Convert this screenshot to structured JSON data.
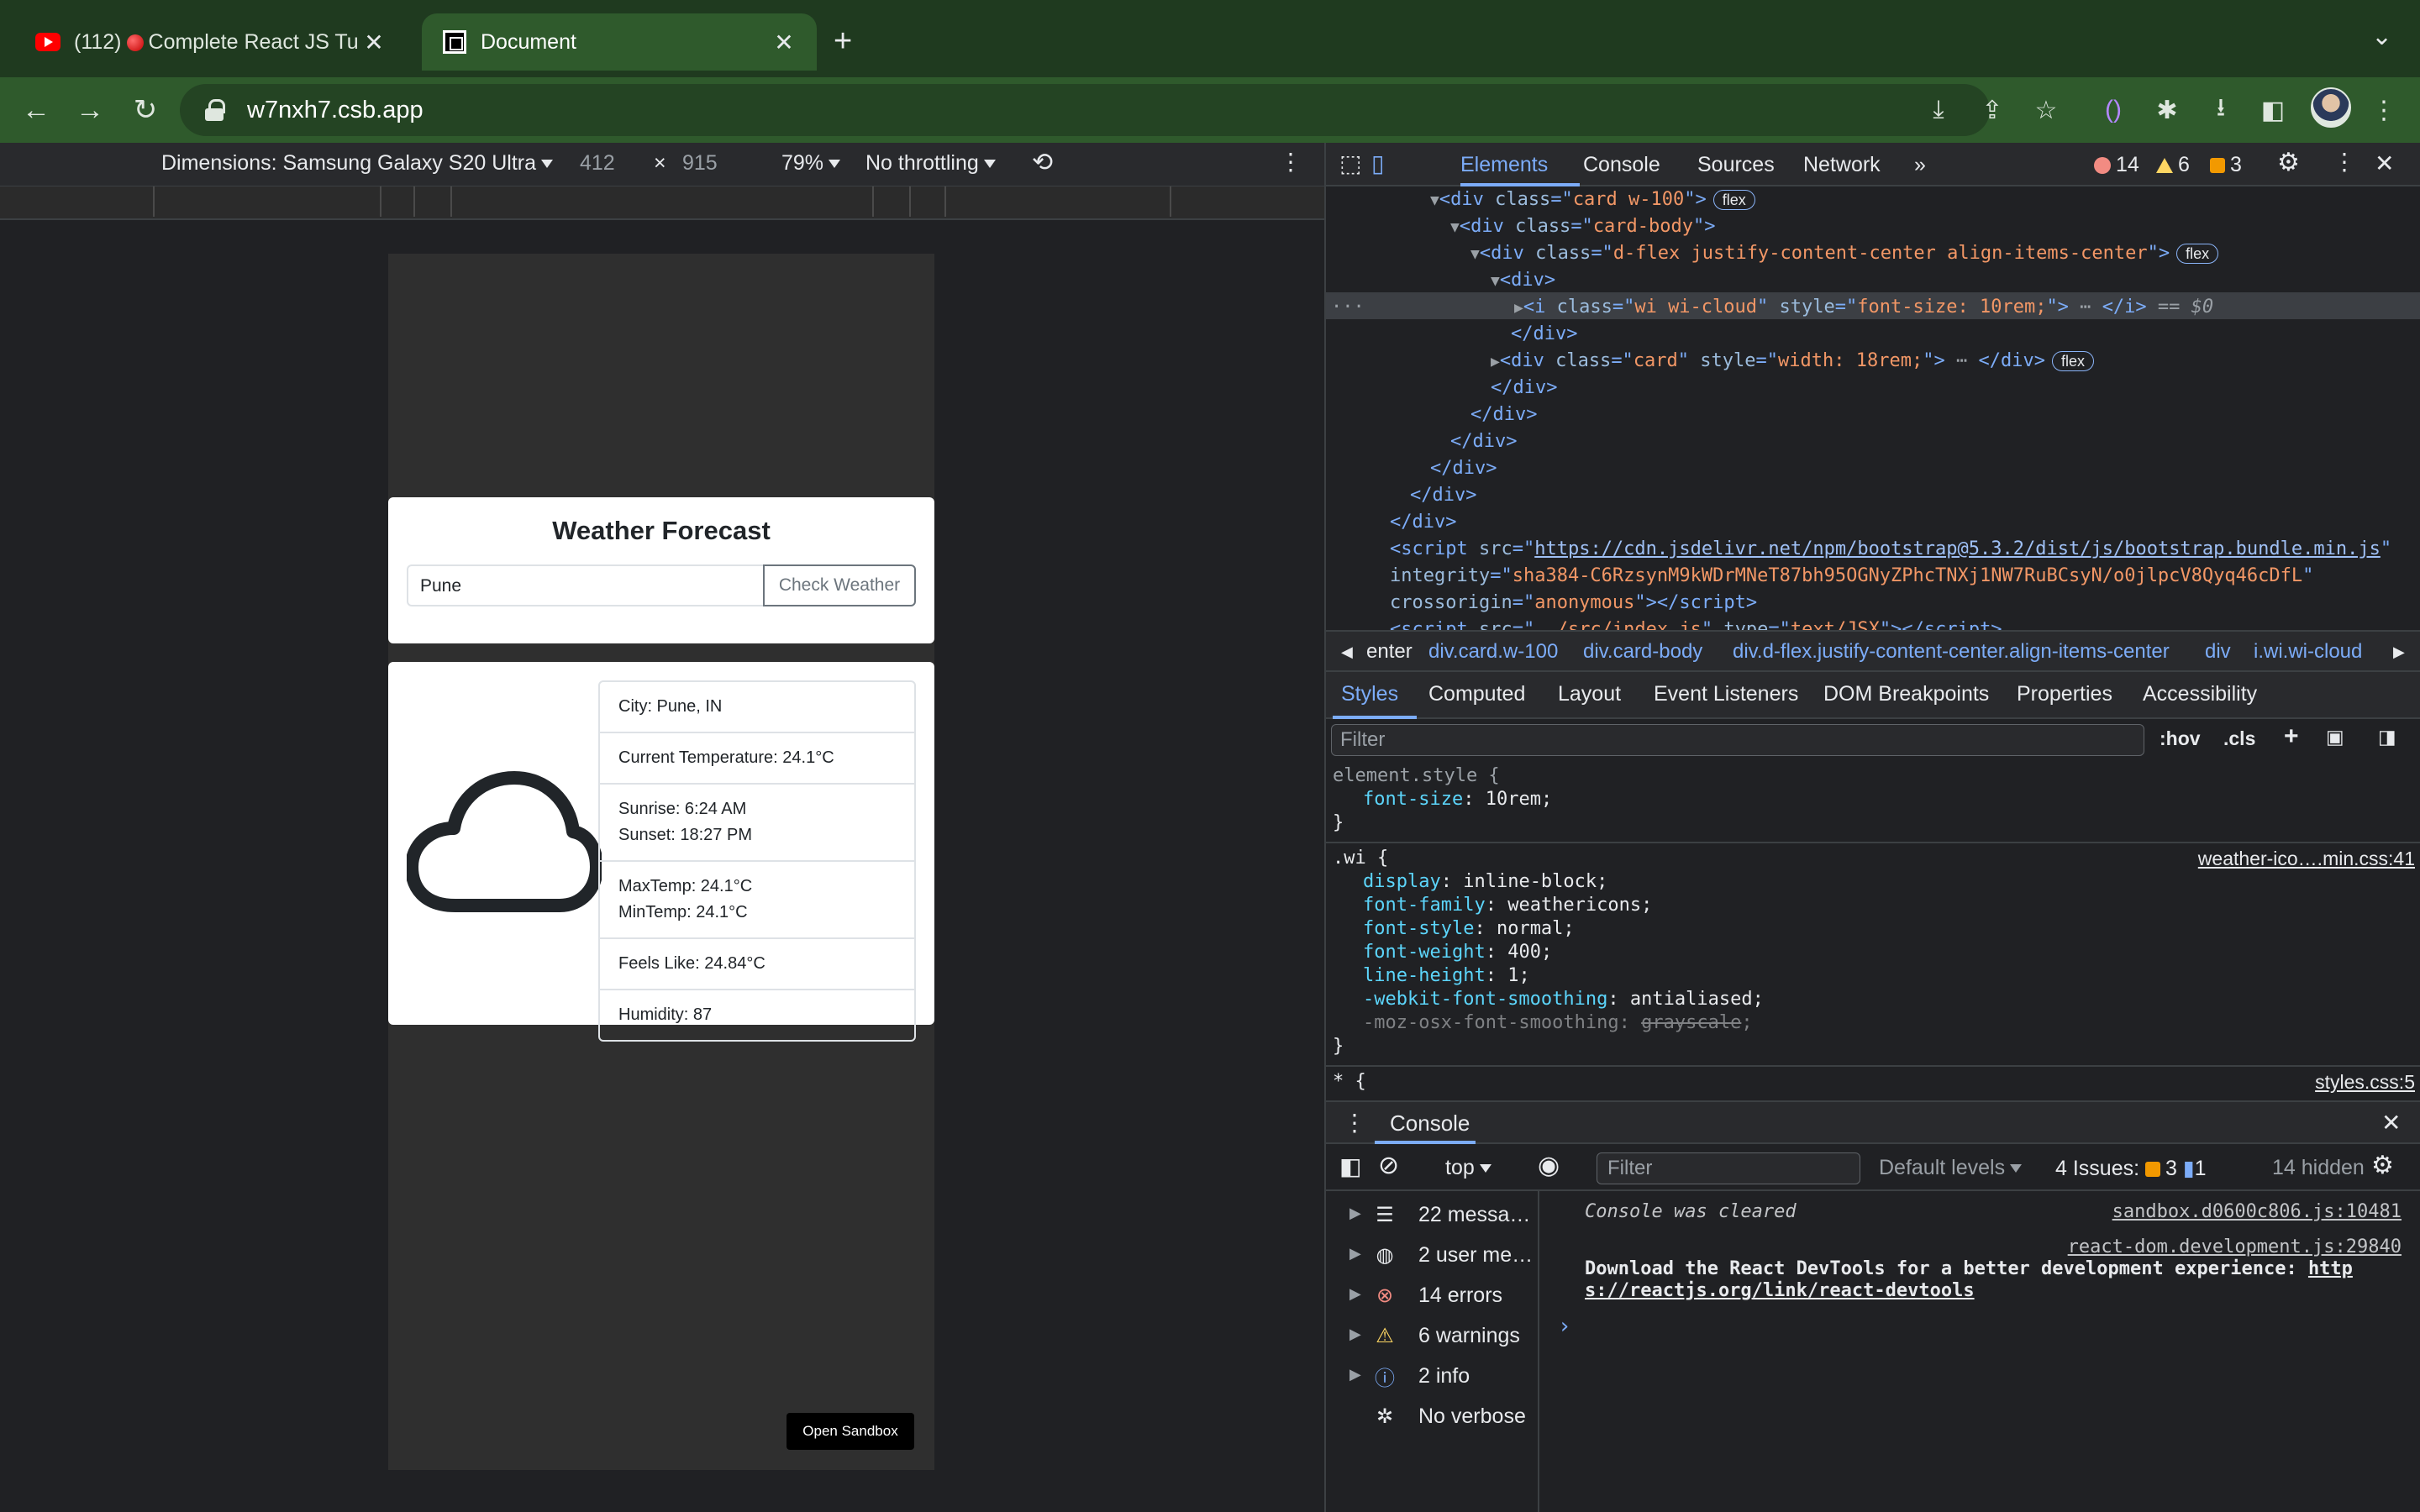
{
  "browser": {
    "tabs": [
      {
        "prefix": "(112)",
        "label": "Complete React JS Tu",
        "active": false
      },
      {
        "label": "Document",
        "active": true
      }
    ],
    "url": "w7nxh7.csb.app"
  },
  "device_toolbar": {
    "dimensions": "Dimensions: Samsung Galaxy S20 Ultra",
    "width": "412",
    "times": "×",
    "height": "915",
    "zoom": "79%",
    "throttling": "No throttling"
  },
  "app": {
    "title": "Weather Forecast",
    "city_value": "Pune",
    "check_button": "Check Weather",
    "info": [
      [
        "City: Pune, IN"
      ],
      [
        "Current Temperature: 24.1°C"
      ],
      [
        "Sunrise: 6:24 AM",
        "Sunset: 18:27 PM"
      ],
      [
        "MaxTemp: 24.1°C",
        "MinTemp: 24.1°C"
      ],
      [
        "Feels Like: 24.84°C"
      ],
      [
        "Humidity: 87"
      ]
    ],
    "open_sandbox": "Open Sandbox"
  },
  "devtools": {
    "tabs": [
      "Elements",
      "Console",
      "Sources",
      "Network"
    ],
    "errors": "14",
    "warnings": "6",
    "issues": "3",
    "dom": {
      "card_div_open": "<div",
      "card_div_class": "card w-100",
      "card_body_class": "card-body",
      "dflex_class": "d-flex justify-content-center align-items-center",
      "icon_class": "wi wi-cloud",
      "icon_style": "font-size: 10rem;",
      "selected_suffix": "== $0",
      "card_style": "width: 18rem;",
      "flex": "flex",
      "script1_src": "https://cdn.jsdelivr.net/npm/bootstrap@5.3.2/dist/js/bootstrap.bundle.min.js",
      "script1_integrity": "sha384-C6RzsynM9kWDrMNeT87bh95OGNyZPhcTNXj1NW7RuBCsyN/o0jlpcV8Qyq46cDfL",
      "script1_crossorigin": "anonymous",
      "script2_src": "../src/index.js",
      "script2_type": "text/JSX"
    },
    "breadcrumbs": [
      "enter",
      "div.card.w-100",
      "div.card-body",
      "div.d-flex.justify-content-center.align-items-center",
      "div",
      "i.wi.wi-cloud"
    ],
    "subtabs": [
      "Styles",
      "Computed",
      "Layout",
      "Event Listeners",
      "DOM Breakpoints",
      "Properties",
      "Accessibility"
    ],
    "filter_placeholder": "Filter",
    "hov": ":hov",
    "cls": ".cls",
    "styles": {
      "element_selector": "element.style {",
      "element_prop": "font-size",
      "element_val": "10rem;",
      "wi_selector": ".wi {",
      "wi_source": "weather-ico….min.css:41",
      "wi_rules": [
        [
          "display",
          "inline-block;"
        ],
        [
          "font-family",
          "weathericons;"
        ],
        [
          "font-style",
          "normal;"
        ],
        [
          "font-weight",
          "400;"
        ],
        [
          "line-height",
          "1;"
        ],
        [
          "-webkit-font-smoothing",
          "antialiased;"
        ]
      ],
      "wi_overridden_prop": "-moz-osx-font-smoothing",
      "wi_overridden_val": "grayscale",
      "star_selector": "* {",
      "star_source": "styles.css:5"
    },
    "console": {
      "title": "Console",
      "context": "top",
      "filter_placeholder": "Filter",
      "levels": "Default levels",
      "issues_label": "4 Issues:",
      "issues_warn": "3",
      "issues_info": "1",
      "hidden": "14 hidden",
      "sidebar": [
        {
          "label": "22 messa…",
          "icon": "list-icon"
        },
        {
          "label": "2 user me…",
          "icon": "user-icon"
        },
        {
          "label": "14 errors",
          "icon": "error-icon"
        },
        {
          "label": "6 warnings",
          "icon": "warning-icon"
        },
        {
          "label": "2 info",
          "icon": "info-icon"
        },
        {
          "label": "No verbose",
          "icon": "bug-icon"
        }
      ],
      "messages": [
        {
          "text": "Console was cleared",
          "source": "sandbox.d0600c806.js:10481"
        },
        {
          "text": "Download the React DevTools for a better development experience: ",
          "link_a": "http",
          "link_b": "s://reactjs.org/link/react-devtools",
          "source": "react-dom.development.js:29840"
        }
      ],
      "prompt": "›"
    }
  },
  "colors": {
    "tabstrip": "#1f3a1f",
    "toolbar": "#2f5a2c",
    "devtools_bg": "#202124",
    "accent": "#7cacf8",
    "error": "#f28b82",
    "warning": "#fdd663"
  }
}
